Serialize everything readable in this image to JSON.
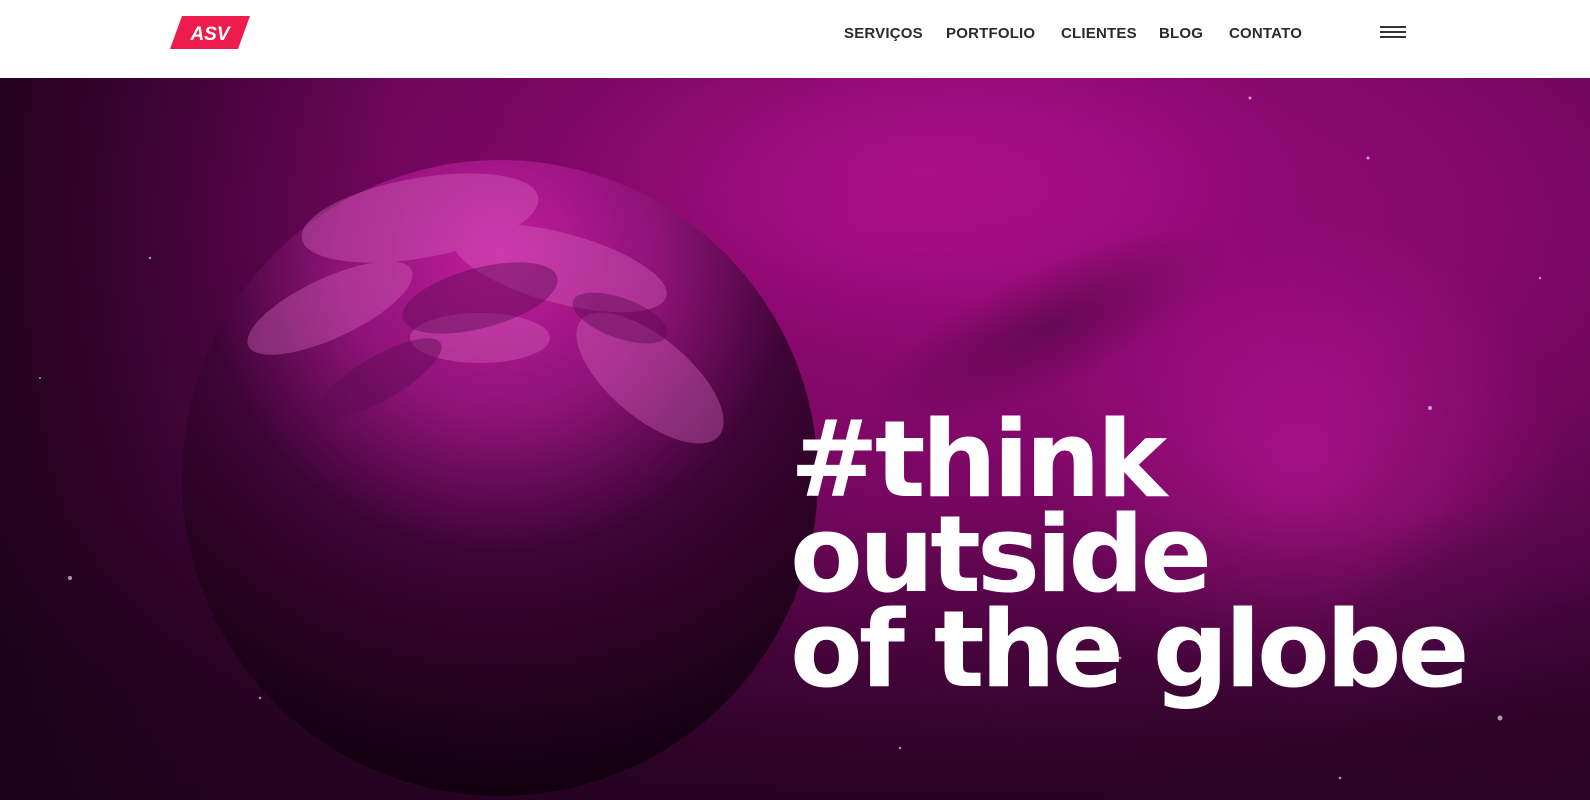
{
  "header": {
    "logo_text": "ASV",
    "brand_color": "#ee1c4d",
    "nav": [
      {
        "label": "SERVIÇOS"
      },
      {
        "label": "PORTFOLIO"
      },
      {
        "label": "CLIENTES"
      },
      {
        "label": "BLOG"
      },
      {
        "label": "CONTATO"
      }
    ],
    "menu_icon": "hamburger-icon"
  },
  "hero": {
    "headline_lines": [
      "#think",
      "outside",
      "of the globe"
    ],
    "background_color": "#a3087f",
    "image": "pink-tinted-earth-in-space"
  }
}
